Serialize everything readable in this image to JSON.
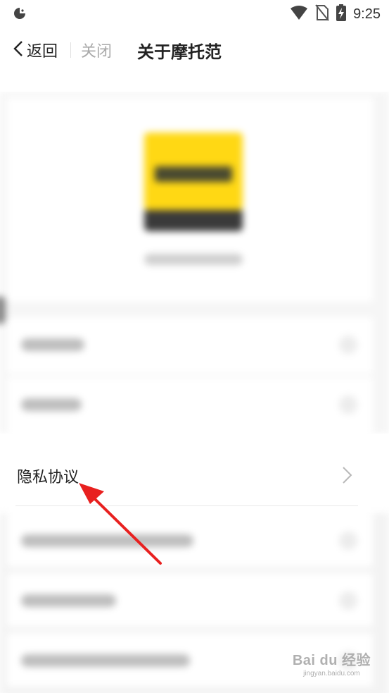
{
  "status_bar": {
    "time": "9:25",
    "app_icon": "pacman-app-icon",
    "icons": [
      "wifi-icon",
      "no-sim-icon",
      "battery-charging-icon"
    ]
  },
  "nav": {
    "back_label": "返回",
    "close_label": "关闭",
    "title": "关于摩托范"
  },
  "highlighted_item": {
    "label": "隐私协议",
    "icon": "chevron-right-icon"
  },
  "annotation": {
    "arrow_color": "#e8201f"
  },
  "watermark": {
    "logo": "Bai du 经验",
    "url": "jingyan.baidu.com"
  },
  "colors": {
    "logo_yellow": "#ffd814",
    "background": "#ffffff"
  }
}
